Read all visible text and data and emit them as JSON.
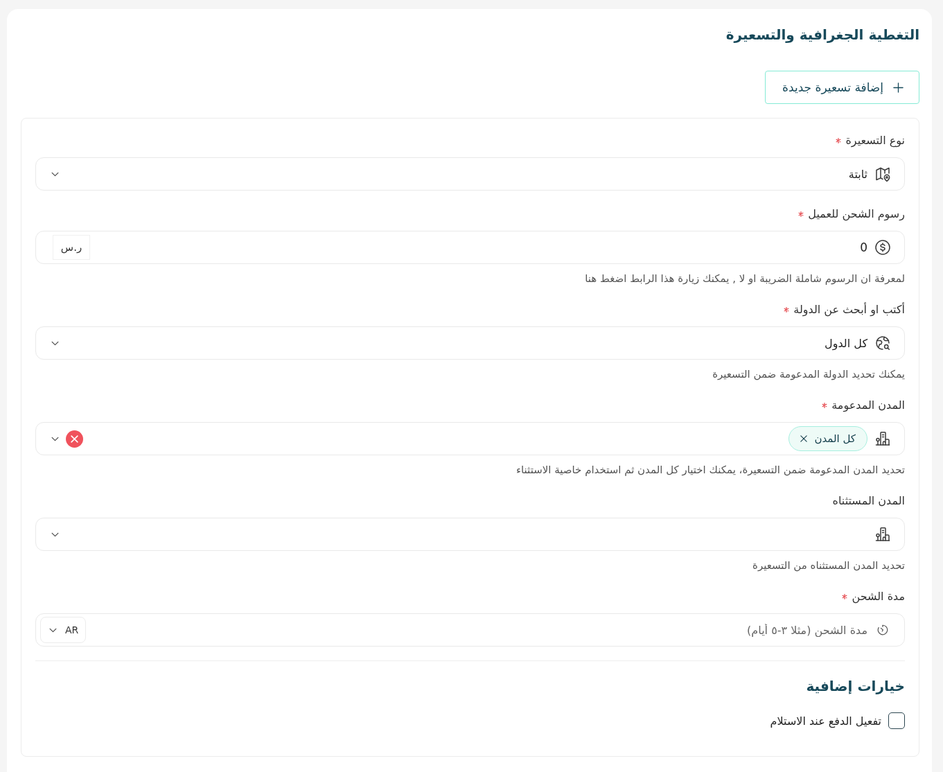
{
  "header": {
    "title": "التغطية الجغرافية والتسعيرة",
    "add_button": "إضافة تسعيرة جديدة"
  },
  "fields": [
    {
      "kind": "select",
      "label": "نوع التسعيرة",
      "required": true,
      "value": "ثابتة"
    },
    {
      "kind": "amount",
      "label": "رسوم الشحن للعميل",
      "required": true,
      "value": "0",
      "addon": "ر.س",
      "helper": "لمعرفة ان الرسوم شاملة الضريبة او لا , يمكنك زيارة هذا الرابط اضغط هنا"
    },
    {
      "kind": "country",
      "label": "أكتب او أبحث عن الدولة",
      "required": true,
      "value": "كل الدول",
      "helper": "يمكنك تحديد الدولة المدعومة ضمن التسعيرة"
    },
    {
      "kind": "cities",
      "label": "المدن المدعومة",
      "required": true,
      "tags": [
        "كل المدن"
      ],
      "helper": "تحديد المدن المدعومة ضمن التسعيرة، يمكنك اختيار كل المدن ثم استخدام خاصية الاستثناء"
    },
    {
      "kind": "cities",
      "label": "المدن المستثناه",
      "required": false,
      "helper": "تحديد المدن المستثناه من التسعيرة"
    },
    {
      "kind": "duration",
      "label": "مدة الشحن",
      "required": true,
      "placeholder": "مدة الشحن (مثلا ٣-٥ أيام)",
      "language": "AR"
    }
  ],
  "extra_options": {
    "title": "خيارات إضافية",
    "options": [
      {
        "label": "تفعيل الدفع عند الاستلام",
        "checked": false
      }
    ]
  }
}
